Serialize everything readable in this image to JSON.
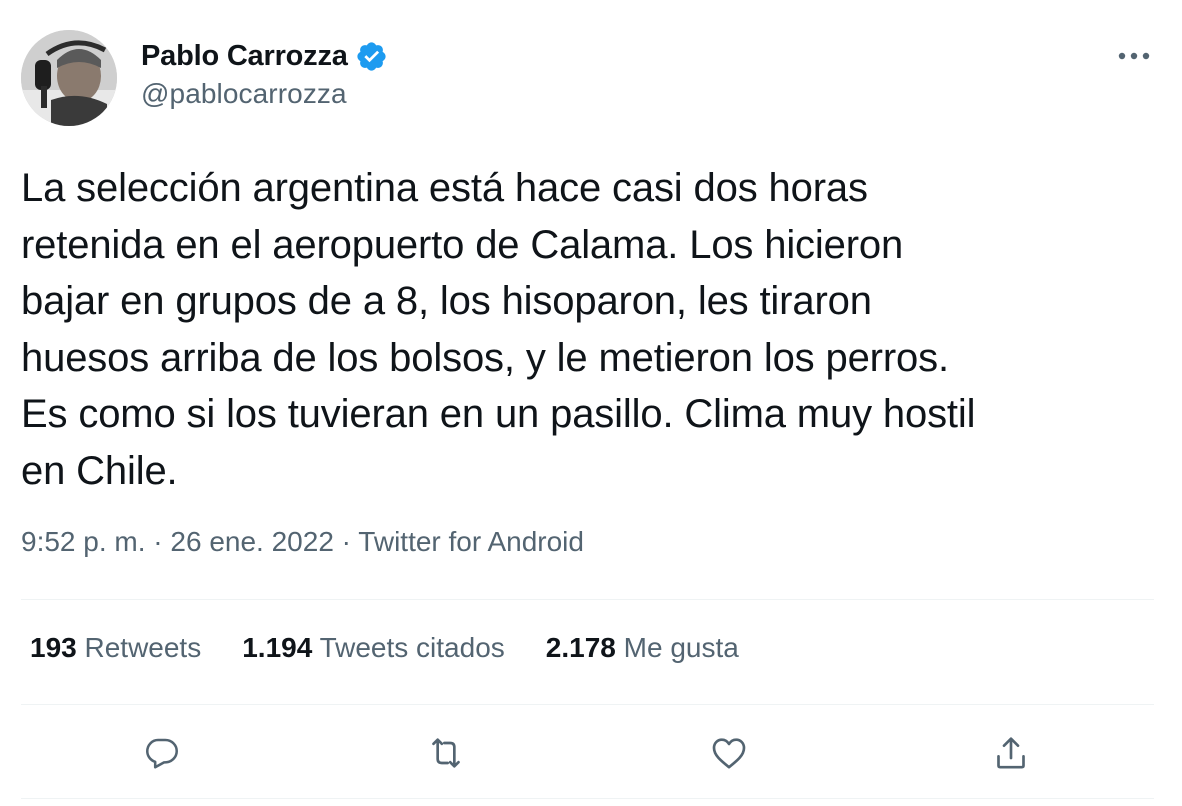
{
  "author": {
    "display_name": "Pablo Carrozza",
    "handle": "@pablocarrozza",
    "verified": true
  },
  "tweet": {
    "lines": [
      "La selección argentina está hace casi dos horas",
      "retenida en el aeropuerto de Calama. Los hicieron",
      "bajar en grupos de a 8, los hisoparon, les tiraron",
      "huesos arriba de los bolsos, y le metieron los perros.",
      "Es como si los tuvieran en un pasillo. Clima muy hostil",
      "en Chile."
    ],
    "time": "9:52 p. m.",
    "separator": " · ",
    "date": "26 ene. 2022",
    "source": "Twitter for Android"
  },
  "stats": {
    "retweets_count": "193",
    "retweets_label": " Retweets",
    "quotes_count": "1.194",
    "quotes_label": " Tweets citados",
    "likes_count": "2.178",
    "likes_label": " Me gusta"
  },
  "icons": {
    "verified": "verified-badge-icon",
    "more": "more-icon",
    "reply": "reply-icon",
    "retweet": "retweet-icon",
    "like": "like-icon",
    "share": "share-icon"
  },
  "colors": {
    "verified_blue": "#1d9bf0",
    "secondary_text": "#536471",
    "primary_text": "#0f1419",
    "divider": "#eff3f4"
  }
}
